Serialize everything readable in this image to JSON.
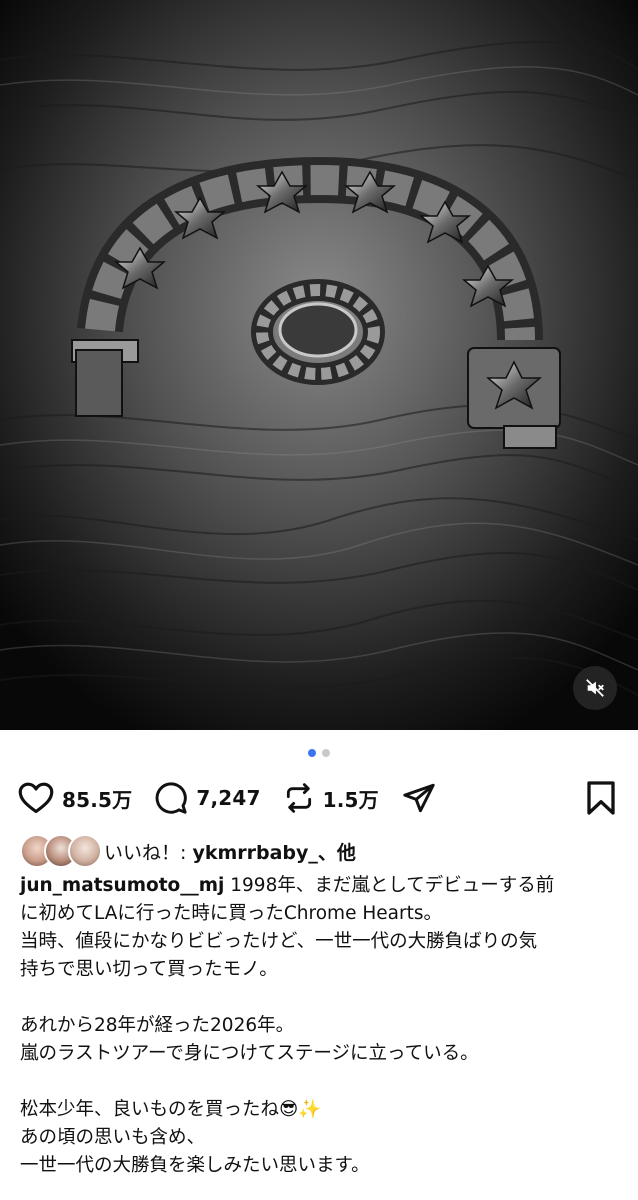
{
  "post": {
    "pagination": {
      "total": 2,
      "active": 0
    },
    "muted": true
  },
  "actions": {
    "likes_count": "85.5万",
    "comments_count": "7,247",
    "reposts_count": "1.5万"
  },
  "liked_by": {
    "prefix": "いいね！: ",
    "user": "ykmrrbaby_",
    "suffix": "、他"
  },
  "caption": {
    "username": "jun_matsumoto__mj",
    "line1": " 1998年、まだ嵐としてデビューする前",
    "line2": "に初めてLAに行った時に買ったChrome Hearts。",
    "line3": "当時、値段にかなりビビったけど、一世一代の大勝負ばりの気",
    "line4": "持ちで思い切って買ったモノ。",
    "line5": "あれから28年が経った2026年。",
    "line6": "嵐のラストツアーで身につけてステージに立っている。",
    "line7": "松本少年、良いものを買ったね😎✨",
    "line8": "あの頃の思いも含め、",
    "line9": "一世一代の大勝負を楽しみたい思います。"
  }
}
